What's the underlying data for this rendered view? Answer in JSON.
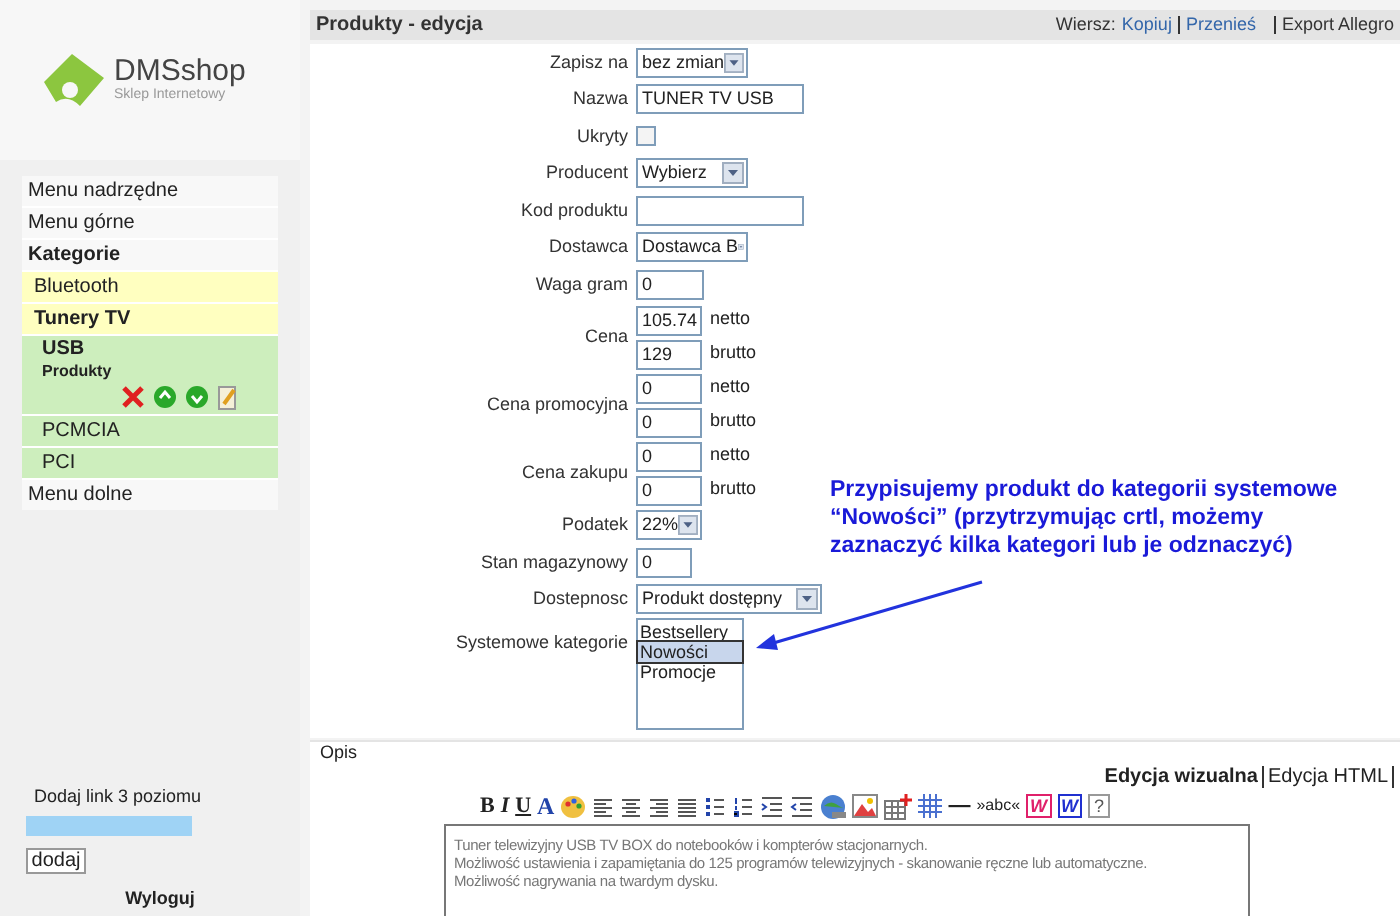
{
  "logo": {
    "name": "DMSshop",
    "tagline": "Sklep Internetowy"
  },
  "sidebar": {
    "items": [
      {
        "kind": "plain",
        "label": "Menu nadrzędne"
      },
      {
        "kind": "plain",
        "label": "Menu górne"
      },
      {
        "kind": "heading",
        "label": "Kategorie"
      },
      {
        "kind": "category",
        "label": "Bluetooth",
        "selected": false
      },
      {
        "kind": "category",
        "label": "Tunery TV",
        "selected": true,
        "children": [
          {
            "kind": "subcategory",
            "label": "USB",
            "sublabel": "Produkty",
            "selected": true
          },
          {
            "kind": "subcategory",
            "label": "PCMCIA",
            "selected": false
          },
          {
            "kind": "subcategory",
            "label": "PCI",
            "selected": false
          }
        ]
      },
      {
        "kind": "plain",
        "label": "Menu dolne"
      }
    ],
    "add_link": {
      "label": "Dodaj link 3 poziomu",
      "button": "dodaj"
    },
    "logout": "Wyloguj"
  },
  "header": {
    "title": "Produkty - edycja",
    "row_label": "Wiersz:",
    "links": [
      "Kopiuj",
      "Przenieś"
    ],
    "export": "Export Allegro"
  },
  "form": [
    {
      "kind": "select",
      "label": "Zapisz na",
      "value": "bez zmian"
    },
    {
      "kind": "text",
      "label": "Nazwa",
      "value": "TUNER TV USB"
    },
    {
      "kind": "checkbox",
      "label": "Ukryty",
      "checked": false
    },
    {
      "kind": "select",
      "label": "Producent",
      "value": "Wybierz"
    },
    {
      "kind": "text",
      "label": "Kod produktu"
    },
    {
      "kind": "select",
      "label": "Dostawca",
      "value": "Dostawca B"
    },
    {
      "kind": "text",
      "label": "Waga gram",
      "value": "0"
    },
    {
      "kind": "pair",
      "label": "Cena",
      "fields": [
        {
          "value": "105.74",
          "unit": "netto"
        },
        {
          "value": "129",
          "unit": "brutto"
        }
      ]
    },
    {
      "kind": "pair",
      "label": "Cena promocyjna",
      "fields": [
        {
          "value": "0",
          "unit": "netto"
        },
        {
          "value": "0",
          "unit": "brutto"
        }
      ]
    },
    {
      "kind": "pair",
      "label": "Cena zakupu",
      "fields": [
        {
          "value": "0",
          "unit": "netto"
        },
        {
          "value": "0",
          "unit": "brutto"
        }
      ]
    },
    {
      "kind": "select",
      "label": "Podatek",
      "value": "22%"
    },
    {
      "kind": "text",
      "label": "Stan magazynowy",
      "value": "0"
    },
    {
      "kind": "select",
      "label": "Dostepnosc",
      "value": "Produkt dostępny"
    },
    {
      "kind": "listbox",
      "label": "Systemowe kategorie",
      "options": [
        {
          "label": "Bestsellery",
          "selected": false
        },
        {
          "label": "Nowości",
          "selected": true
        },
        {
          "label": "Promocje",
          "selected": false
        }
      ]
    }
  ],
  "annotation": {
    "lines": [
      "Przypisujemy produkt do kategorii systemowe",
      "“Nowości” (przytrzymując crtl, możemy",
      "zaznaczyć kilka kategori lub je odznaczyć)"
    ]
  },
  "description": {
    "label": "Opis",
    "tabs": [
      {
        "label": "Edycja wizualna",
        "selected": true
      },
      {
        "label": "Edycja HTML",
        "selected": false
      }
    ],
    "toolbar_start": [
      "B",
      "I",
      "U",
      "A"
    ],
    "toolbar_end": [
      "—",
      "»abc«",
      "W",
      "W",
      "?"
    ],
    "lines": [
      "Tuner telewizyjny USB TV BOX do notebooków i kompterów stacjonarnych.",
      "Możliwość ustawienia i zapamiętania do 125 programów telewizyjnych - skanowanie ręczne lub automatyczne.",
      "Możliwość nagrywania na twardym dysku."
    ]
  }
}
